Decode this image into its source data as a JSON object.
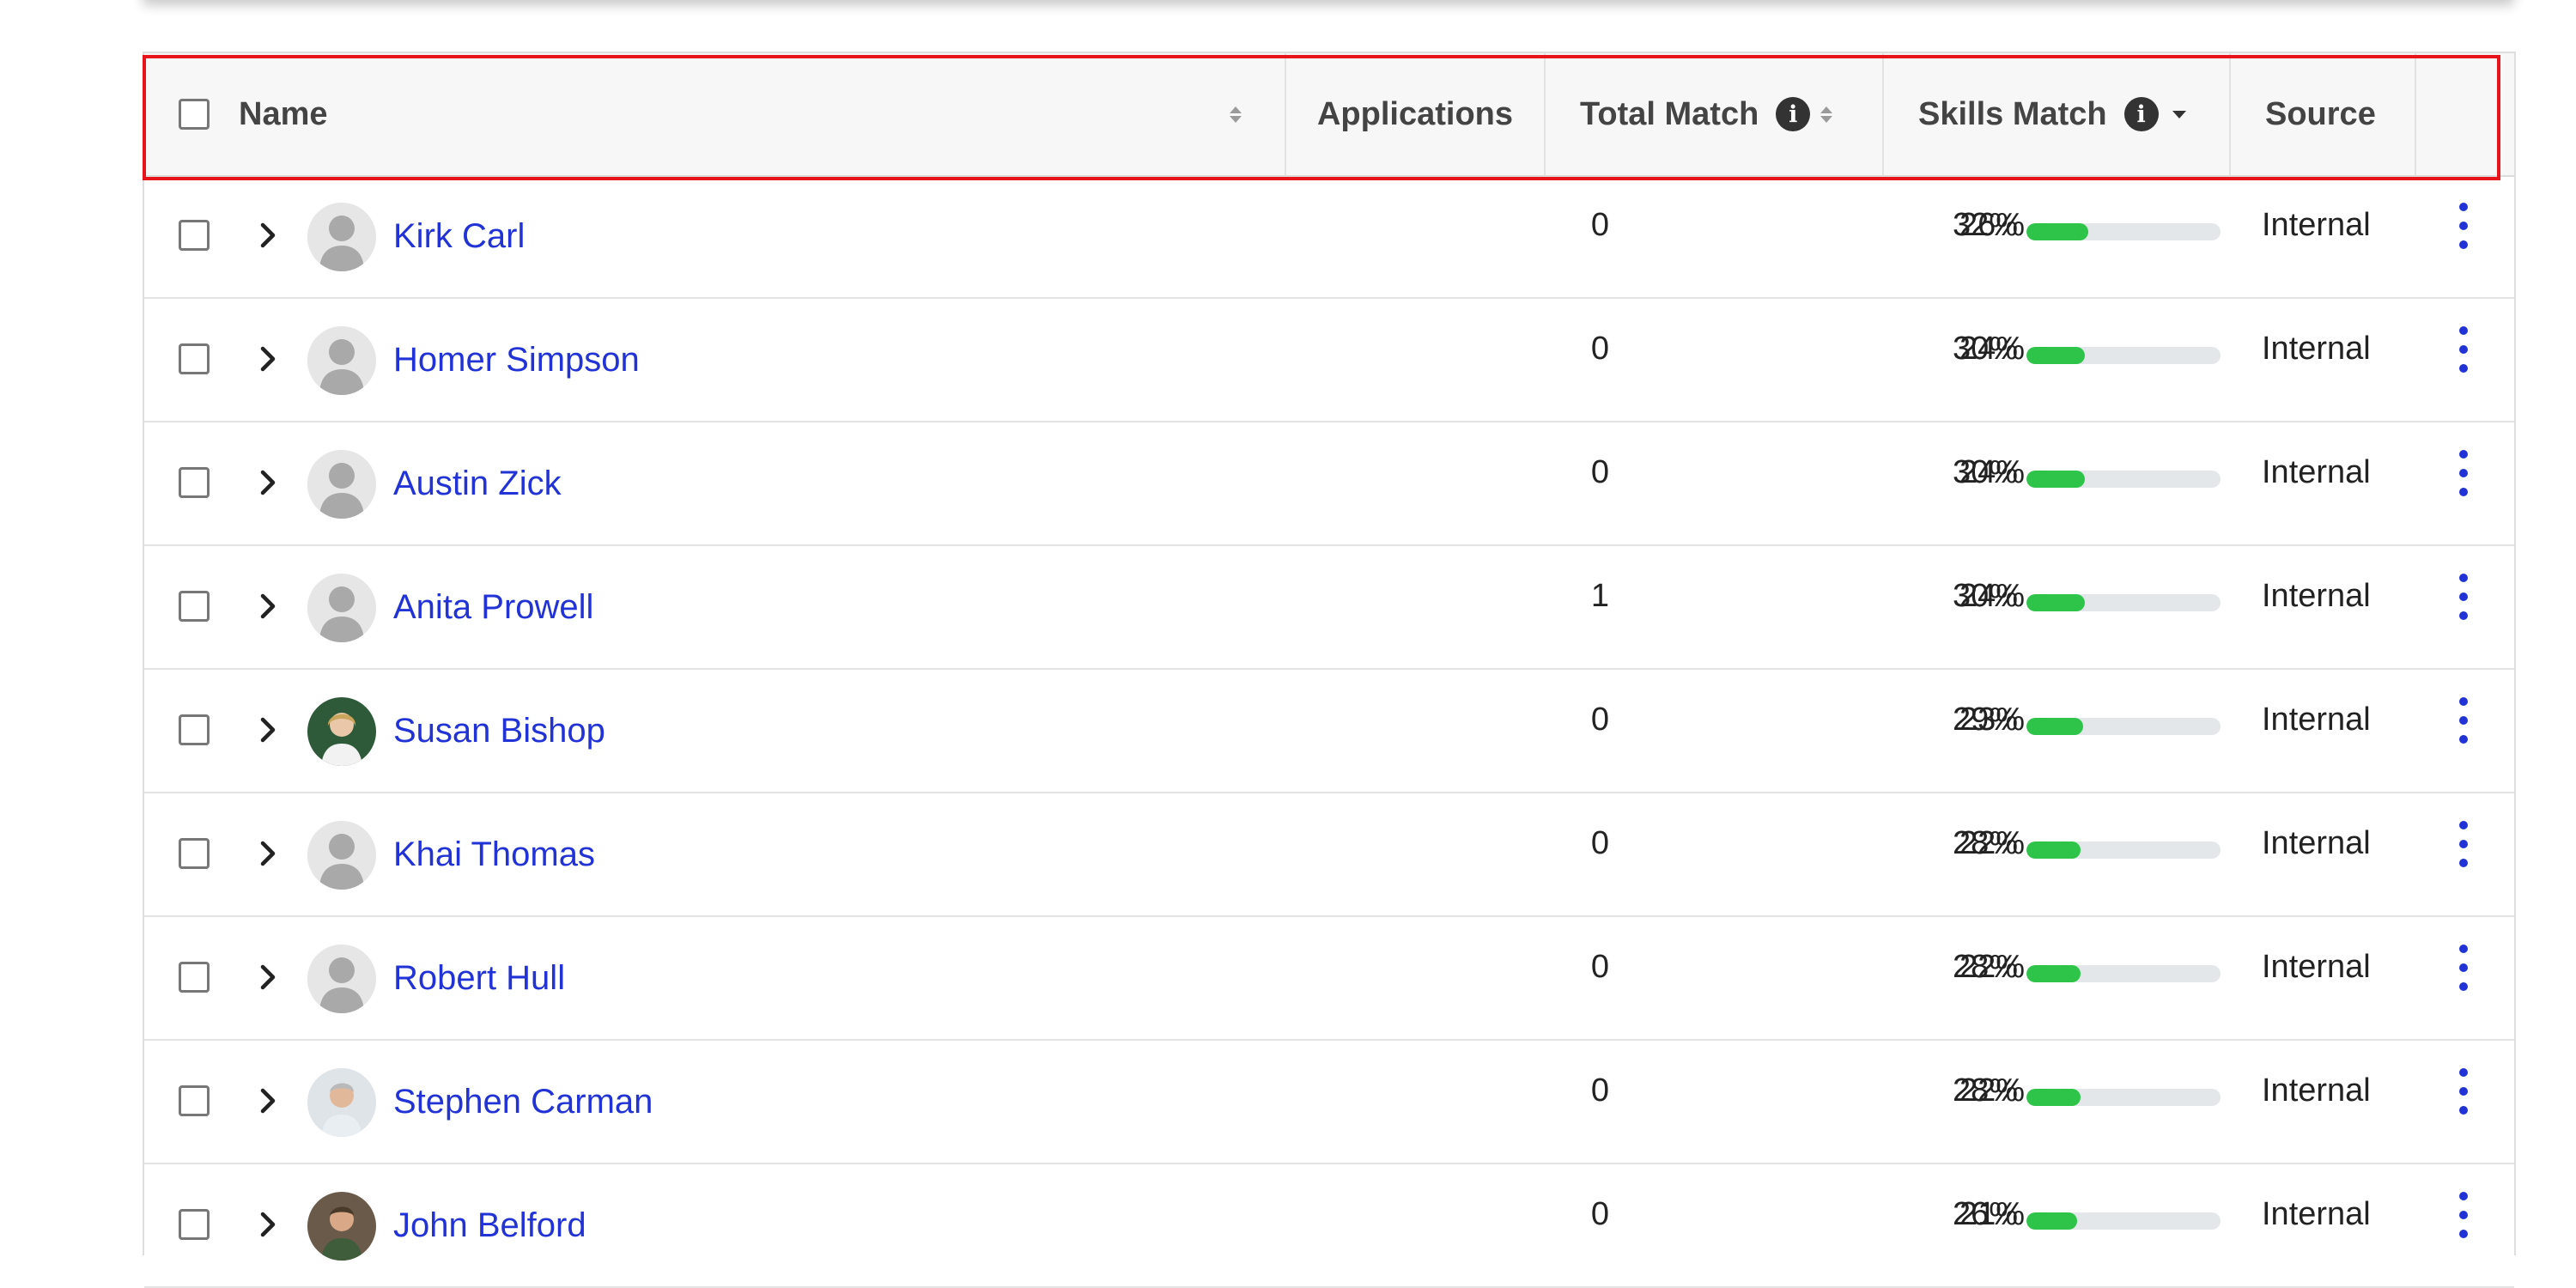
{
  "header": {
    "name": "Name",
    "applications": "Applications",
    "total_match": "Total Match",
    "skills_match": "Skills Match",
    "source": "Source"
  },
  "colors": {
    "link": "#2133d6",
    "bar_fill": "#2ec44a",
    "bar_track": "#e4e7ea",
    "highlight": "#e8141c"
  },
  "rows": [
    {
      "name": "Kirk Carl",
      "avatar": "placeholder",
      "applications": "0",
      "total_match": "26%",
      "skills_match": "32%",
      "skills_value": 0.32,
      "source": "Internal"
    },
    {
      "name": "Homer Simpson",
      "avatar": "placeholder",
      "applications": "0",
      "total_match": "24%",
      "skills_match": "30%",
      "skills_value": 0.3,
      "source": "Internal"
    },
    {
      "name": "Austin Zick",
      "avatar": "placeholder",
      "applications": "0",
      "total_match": "24%",
      "skills_match": "30%",
      "skills_value": 0.3,
      "source": "Internal"
    },
    {
      "name": "Anita Prowell",
      "avatar": "placeholder",
      "applications": "1",
      "total_match": "24%",
      "skills_match": "30%",
      "skills_value": 0.3,
      "source": "Internal"
    },
    {
      "name": "Susan Bishop",
      "avatar": "photo",
      "applications": "0",
      "total_match": "23%",
      "skills_match": "29%",
      "skills_value": 0.29,
      "source": "Internal"
    },
    {
      "name": "Khai Thomas",
      "avatar": "placeholder",
      "applications": "0",
      "total_match": "22%",
      "skills_match": "28%",
      "skills_value": 0.28,
      "source": "Internal"
    },
    {
      "name": "Robert Hull",
      "avatar": "placeholder",
      "applications": "0",
      "total_match": "22%",
      "skills_match": "28%",
      "skills_value": 0.28,
      "source": "Internal"
    },
    {
      "name": "Stephen Carman",
      "avatar": "photo",
      "applications": "0",
      "total_match": "22%",
      "skills_match": "28%",
      "skills_value": 0.28,
      "source": "Internal"
    },
    {
      "name": "John Belford",
      "avatar": "photo",
      "applications": "0",
      "total_match": "21%",
      "skills_match": "26%",
      "skills_value": 0.26,
      "source": "Internal"
    }
  ]
}
